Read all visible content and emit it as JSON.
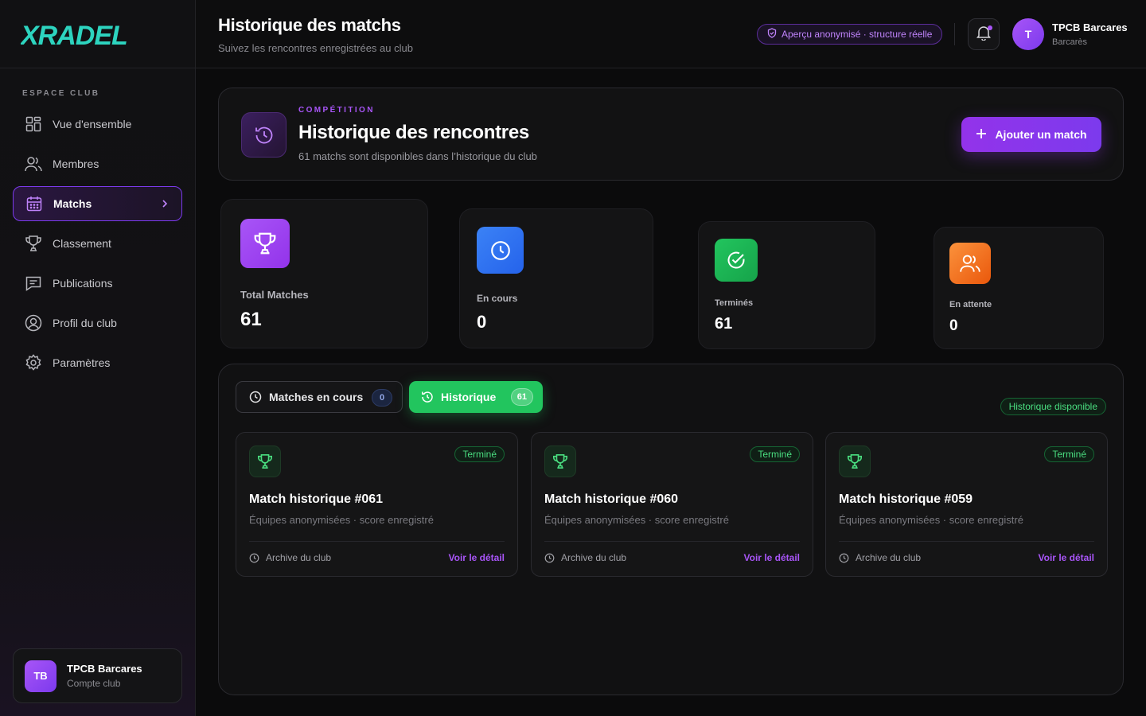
{
  "brand": {
    "logo": "XRADEL",
    "logo_color": "#2dd4bf"
  },
  "sidebar": {
    "section_label": "ESPACE CLUB",
    "items": [
      {
        "label": "Vue d'ensemble",
        "icon": "grid-icon"
      },
      {
        "label": "Membres",
        "icon": "users-icon"
      },
      {
        "label": "Matchs",
        "icon": "calendar-icon",
        "active": true
      },
      {
        "label": "Classement",
        "icon": "trophy-icon"
      },
      {
        "label": "Publications",
        "icon": "message-icon"
      },
      {
        "label": "Profil du club",
        "icon": "profile-icon"
      },
      {
        "label": "Paramètres",
        "icon": "settings-icon"
      }
    ],
    "account": {
      "initials": "TB",
      "name": "TPCB Barcares",
      "sub": "Compte club"
    }
  },
  "header": {
    "title": "Historique des matchs",
    "subtitle": "Suivez les rencontres enregistrées au club",
    "preview_badge": "Aperçu anonymisé · structure réelle",
    "user": {
      "initial": "T",
      "name": "TPCB Barcares",
      "sub": "Barcarès"
    }
  },
  "hero": {
    "kicker": "COMPÉTITION",
    "title": "Historique des rencontres",
    "subtitle": "61 matchs sont disponibles dans l’historique du club",
    "add_button": "Ajouter un match"
  },
  "stats": [
    {
      "label": "Total Matches",
      "value": "61",
      "color": "#a855f7",
      "icon": "trophy-icon"
    },
    {
      "label": "En cours",
      "value": "0",
      "color": "#3b82f6",
      "icon": "clock-icon"
    },
    {
      "label": "Terminés",
      "value": "61",
      "color": "#22c55e",
      "icon": "check-circle-icon"
    },
    {
      "label": "En attente",
      "value": "0",
      "color": "#f97316",
      "icon": "users-icon"
    }
  ],
  "tabs": {
    "live": {
      "label": "Matches en cours",
      "count": "0"
    },
    "history": {
      "label": "Historique",
      "count": "61"
    }
  },
  "history_badge": "Historique disponible",
  "matches": [
    {
      "status": "Terminé",
      "title": "Match historique #061",
      "sub": "Équipes anonymisées · score enregistré",
      "archive": "Archive du club",
      "link": "Voir le détail"
    },
    {
      "status": "Terminé",
      "title": "Match historique #060",
      "sub": "Équipes anonymisées · score enregistré",
      "archive": "Archive du club",
      "link": "Voir le détail"
    },
    {
      "status": "Terminé",
      "title": "Match historique #059",
      "sub": "Équipes anonymisées · score enregistré",
      "archive": "Archive du club",
      "link": "Voir le détail"
    }
  ]
}
